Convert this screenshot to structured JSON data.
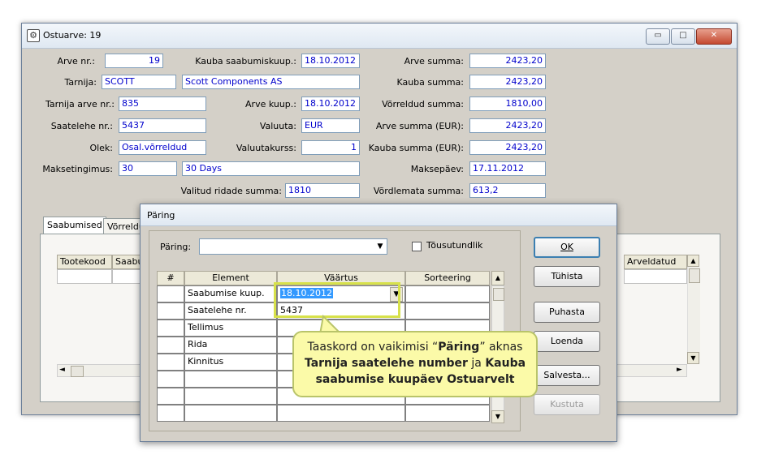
{
  "window": {
    "title": "Ostuarve: 19",
    "controls": {
      "minimize": "▭",
      "maximize": "□",
      "close": "✕"
    }
  },
  "invoice": {
    "arve_nr": {
      "label": "Arve nr.:",
      "value": "19"
    },
    "kauba_saabumiskuup": {
      "label": "Kauba saabumiskuup.:",
      "value": "18.10.2012"
    },
    "arve_summa": {
      "label": "Arve summa:",
      "value": "2423,20"
    },
    "tarnija": {
      "label": "Tarnija:",
      "code": "SCOTT",
      "name": "Scott Components AS"
    },
    "kauba_summa": {
      "label": "Kauba summa:",
      "value": "2423,20"
    },
    "tarnija_arve_nr": {
      "label": "Tarnija arve nr.:",
      "value": "835"
    },
    "arve_kuup": {
      "label": "Arve kuup.:",
      "value": "18.10.2012"
    },
    "vorreldud_summa": {
      "label": "Võrreldud summa:",
      "value": "1810,00"
    },
    "saatelehe_nr": {
      "label": "Saatelehe nr.:",
      "value": "5437"
    },
    "valuuta": {
      "label": "Valuuta:",
      "value": "EUR"
    },
    "arve_summa_eur": {
      "label": "Arve summa (EUR):",
      "value": "2423,20"
    },
    "olek": {
      "label": "Olek:",
      "value": "Osal.võrreldud"
    },
    "valuutakurss": {
      "label": "Valuutakurss:",
      "value": "1"
    },
    "kauba_summa_eur": {
      "label": "Kauba summa (EUR):",
      "value": "2423,20"
    },
    "maksetingimus": {
      "label": "Maksetingimus:",
      "code": "30",
      "name": "30 Days"
    },
    "maksepaev": {
      "label": "Maksepäev:",
      "value": "17.11.2012"
    },
    "valitud_ridade_summa": {
      "label": "Valitud ridade summa:",
      "value": "1810"
    },
    "vordlemata_summa": {
      "label": "Võrdlemata summa:",
      "value": "613,2"
    }
  },
  "tabs": {
    "saabumised": "Saabumised",
    "vorreldud": "Võrreldu"
  },
  "grid": {
    "col_tootekood": "Tootekood",
    "col_saabu": "Saabu",
    "col_arveldatud": "Arveldatud"
  },
  "dialog": {
    "title": "Päring",
    "query_label": "Päring:",
    "query_value": "",
    "checkbox_label": "Tõusutundlik",
    "headers": {
      "num": "#",
      "element": "Element",
      "vaartus": "Väärtus",
      "sorteering": "Sorteering"
    },
    "rows": [
      {
        "element": "Saabumise kuup.",
        "value": "18.10.2012"
      },
      {
        "element": "Saatelehe nr.",
        "value": "5437"
      },
      {
        "element": "Tellimus",
        "value": ""
      },
      {
        "element": "Rida",
        "value": ""
      },
      {
        "element": "Kinnitus",
        "value": ""
      }
    ],
    "buttons": {
      "ok": "OK",
      "tuhista": "Tühista",
      "puhasta": "Puhasta",
      "loenda": "Loenda",
      "salvesta": "Salvesta...",
      "kustuta": "Kustuta"
    }
  },
  "callout": {
    "line1_pre": "Taaskord on vaikimisi “",
    "line1_bold": "Päring",
    "line1_post": "” aknas",
    "line2_bold_a": "Tarnija saatelehe number",
    "line2_mid": " ja ",
    "line2_bold_b": "Kauba",
    "line3_bold": "saabumise kuupäev Ostuarvelt"
  }
}
